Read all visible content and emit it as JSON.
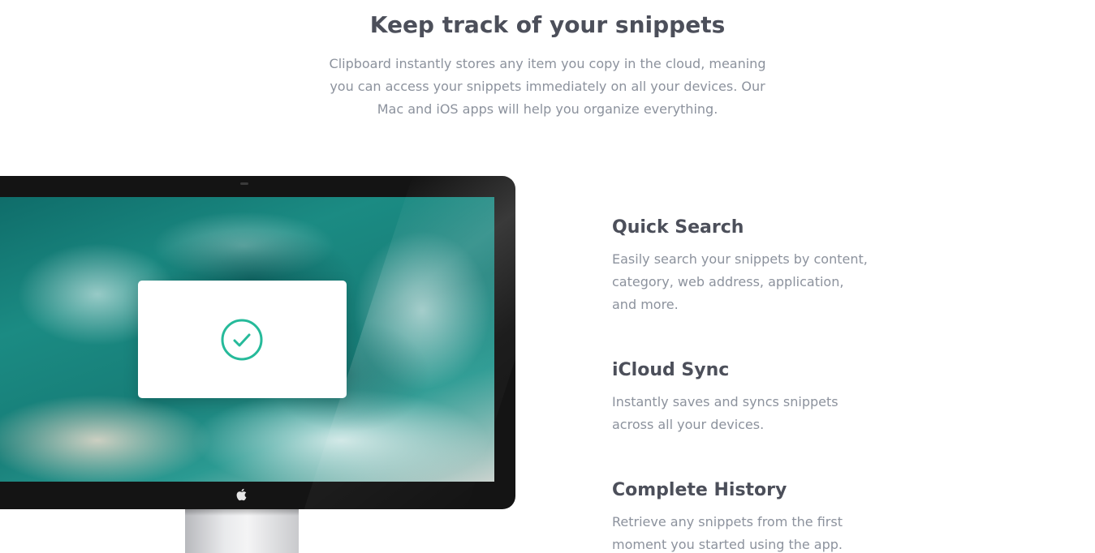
{
  "intro": {
    "title": "Keep track of your snippets",
    "description": "Clipboard instantly stores any item you copy in the cloud, meaning you can access your snippets immediately on all your devices. Our Mac and iOS apps will help you organize everything."
  },
  "features": [
    {
      "title": "Quick Search",
      "description": "Easily search your snippets by content, category, web address, application, and more."
    },
    {
      "title": "iCloud Sync",
      "description": "Instantly saves and syncs snippets across all your devices."
    },
    {
      "title": "Complete History",
      "description": "Retrieve any snippets from the first moment you started using the app."
    }
  ],
  "colors": {
    "heading": "#4c4f5a",
    "body_text": "#8c929d",
    "accent": "#26ba9a"
  },
  "icons": {
    "checkmark": "check-circle-icon",
    "brand": "apple-icon"
  }
}
